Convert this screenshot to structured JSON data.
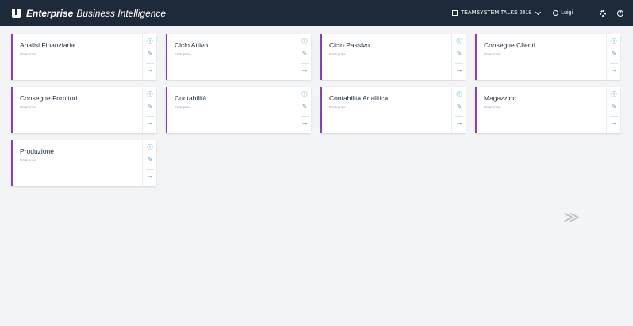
{
  "app": {
    "brand_strong": "Enterprise",
    "brand_rest": "Business Intelligence",
    "company": "TEAMSYSTEM TALKS 2018",
    "user": "Luigi"
  },
  "tiles": [
    {
      "title": "Analisi Finanziaria",
      "subtitle": "Enterprise"
    },
    {
      "title": "Ciclo Attivo",
      "subtitle": "Enterprise"
    },
    {
      "title": "Ciclo Passivo",
      "subtitle": "Enterprise"
    },
    {
      "title": "Consegne Clienti",
      "subtitle": "Enterprise"
    },
    {
      "title": "Consegne Fornitori",
      "subtitle": "Enterprise"
    },
    {
      "title": "Contabilità",
      "subtitle": "Enterprise"
    },
    {
      "title": "Contabilità Analitica",
      "subtitle": "Enterprise"
    },
    {
      "title": "Magazzino",
      "subtitle": "Enterprise"
    },
    {
      "title": "Produzione",
      "subtitle": "Enterprise"
    }
  ],
  "icons": {
    "info": "info-icon",
    "edit": "edit-icon",
    "open": "arrow-right-icon",
    "next": "double-chevron-right-icon"
  },
  "colors": {
    "topbar": "#1e2a3a",
    "tile_accent": "#8a3fb8",
    "action": "#1b8fcf"
  }
}
